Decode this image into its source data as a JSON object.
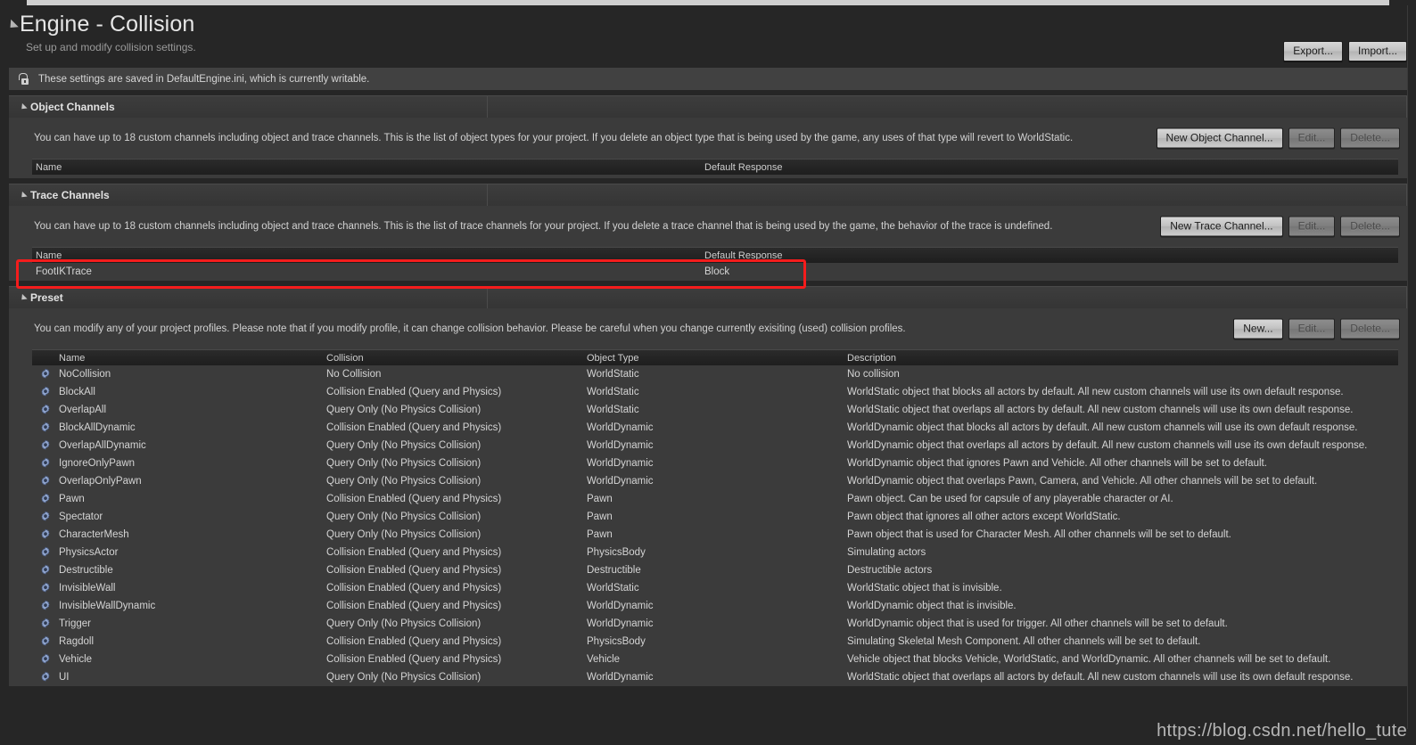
{
  "header": {
    "title": "Engine - Collision",
    "subtitle": "Set up and modify collision settings.",
    "export_label": "Export...",
    "import_label": "Import...",
    "notice": "These settings are saved in DefaultEngine.ini, which is currently writable."
  },
  "object_channels": {
    "title": "Object Channels",
    "description": "You can have up to 18 custom channels including object and trace channels. This is the list of object types for your project. If you delete an object type that is being used by the game, any uses of that type will revert to WorldStatic.",
    "new_label": "New Object Channel...",
    "edit_label": "Edit...",
    "delete_label": "Delete...",
    "columns": [
      "Name",
      "Default Response"
    ],
    "rows": []
  },
  "trace_channels": {
    "title": "Trace Channels",
    "description": "You can have up to 18 custom channels including object and trace channels. This is the list of trace channels for your project. If you delete a trace channel that is being used by the game, the behavior of the trace is undefined.",
    "new_label": "New Trace Channel...",
    "edit_label": "Edit...",
    "delete_label": "Delete...",
    "columns": [
      "Name",
      "Default Response"
    ],
    "rows": [
      {
        "name": "FootIKTrace",
        "response": "Block"
      }
    ]
  },
  "preset": {
    "title": "Preset",
    "description": "You can modify any of your project profiles. Please note that if you modify profile, it can change collision behavior. Please be careful when you change currently exisiting (used) collision profiles.",
    "new_label": "New...",
    "edit_label": "Edit...",
    "delete_label": "Delete...",
    "columns": [
      "Name",
      "Collision",
      "Object Type",
      "Description"
    ],
    "rows": [
      {
        "name": "NoCollision",
        "collision": "No Collision",
        "object_type": "WorldStatic",
        "description": "No collision"
      },
      {
        "name": "BlockAll",
        "collision": "Collision Enabled (Query and Physics)",
        "object_type": "WorldStatic",
        "description": "WorldStatic object that blocks all actors by default. All new custom channels will use its own default response."
      },
      {
        "name": "OverlapAll",
        "collision": "Query Only (No Physics Collision)",
        "object_type": "WorldStatic",
        "description": "WorldStatic object that overlaps all actors by default. All new custom channels will use its own default response."
      },
      {
        "name": "BlockAllDynamic",
        "collision": "Collision Enabled (Query and Physics)",
        "object_type": "WorldDynamic",
        "description": "WorldDynamic object that blocks all actors by default. All new custom channels will use its own default response."
      },
      {
        "name": "OverlapAllDynamic",
        "collision": "Query Only (No Physics Collision)",
        "object_type": "WorldDynamic",
        "description": "WorldDynamic object that overlaps all actors by default. All new custom channels will use its own default response."
      },
      {
        "name": "IgnoreOnlyPawn",
        "collision": "Query Only (No Physics Collision)",
        "object_type": "WorldDynamic",
        "description": "WorldDynamic object that ignores Pawn and Vehicle. All other channels will be set to default."
      },
      {
        "name": "OverlapOnlyPawn",
        "collision": "Query Only (No Physics Collision)",
        "object_type": "WorldDynamic",
        "description": "WorldDynamic object that overlaps Pawn, Camera, and Vehicle. All other channels will be set to default."
      },
      {
        "name": "Pawn",
        "collision": "Collision Enabled (Query and Physics)",
        "object_type": "Pawn",
        "description": "Pawn object. Can be used for capsule of any playerable character or AI."
      },
      {
        "name": "Spectator",
        "collision": "Query Only (No Physics Collision)",
        "object_type": "Pawn",
        "description": "Pawn object that ignores all other actors except WorldStatic."
      },
      {
        "name": "CharacterMesh",
        "collision": "Query Only (No Physics Collision)",
        "object_type": "Pawn",
        "description": "Pawn object that is used for Character Mesh. All other channels will be set to default."
      },
      {
        "name": "PhysicsActor",
        "collision": "Collision Enabled (Query and Physics)",
        "object_type": "PhysicsBody",
        "description": "Simulating actors"
      },
      {
        "name": "Destructible",
        "collision": "Collision Enabled (Query and Physics)",
        "object_type": "Destructible",
        "description": "Destructible actors"
      },
      {
        "name": "InvisibleWall",
        "collision": "Collision Enabled (Query and Physics)",
        "object_type": "WorldStatic",
        "description": "WorldStatic object that is invisible."
      },
      {
        "name": "InvisibleWallDynamic",
        "collision": "Collision Enabled (Query and Physics)",
        "object_type": "WorldDynamic",
        "description": "WorldDynamic object that is invisible."
      },
      {
        "name": "Trigger",
        "collision": "Query Only (No Physics Collision)",
        "object_type": "WorldDynamic",
        "description": "WorldDynamic object that is used for trigger. All other channels will be set to default."
      },
      {
        "name": "Ragdoll",
        "collision": "Collision Enabled (Query and Physics)",
        "object_type": "PhysicsBody",
        "description": "Simulating Skeletal Mesh Component. All other channels will be set to default."
      },
      {
        "name": "Vehicle",
        "collision": "Collision Enabled (Query and Physics)",
        "object_type": "Vehicle",
        "description": "Vehicle object that blocks Vehicle, WorldStatic, and WorldDynamic. All other channels will be set to default."
      },
      {
        "name": "UI",
        "collision": "Query Only (No Physics Collision)",
        "object_type": "WorldDynamic",
        "description": "WorldStatic object that overlaps all actors by default. All new custom channels will use its own default response."
      }
    ]
  },
  "watermark": "https://blog.csdn.net/hello_tute",
  "colors": {
    "background": "#262626",
    "panel": "#3b3b3b",
    "header_bar": "#3d3d3d",
    "annotation": "#f41c1c",
    "text": "#d4d4d4"
  }
}
